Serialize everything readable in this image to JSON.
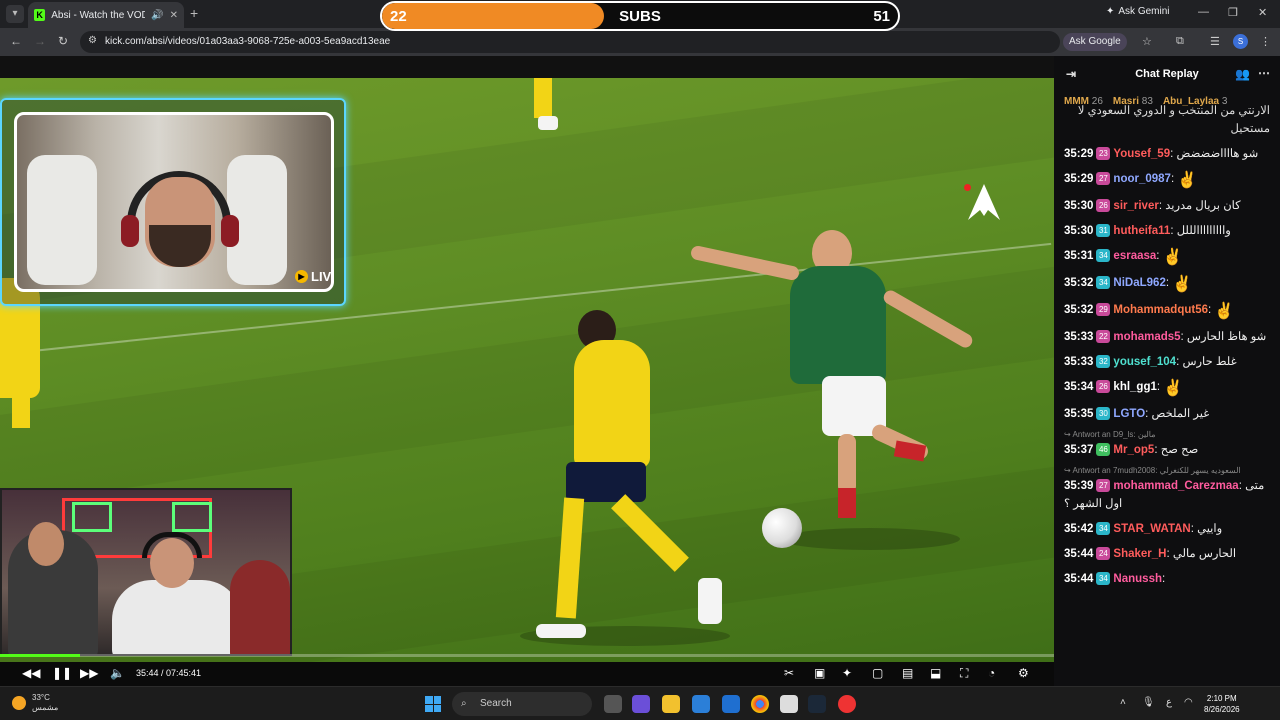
{
  "browser": {
    "tab_title": "Absi - Watch the VOD on K",
    "favicon_letter": "K",
    "url": "kick.com/absi/videos/01a03aa3-9068-725e-a003-5ea9acd13eae",
    "ask_gemini": "Ask Gemini",
    "ask_google": "Ask Google",
    "profile_initial": "S"
  },
  "subs_bar": {
    "left_value": "22",
    "label": "SUBS",
    "right_value": "51",
    "fill_fraction": 0.43,
    "fill_color": "#f08a24"
  },
  "webcam": {
    "live_label": "LIVE"
  },
  "player": {
    "time": "35:44 / 07:45:41",
    "progress_fraction": 0.076,
    "accent": "#53fc18"
  },
  "chat": {
    "title": "Chat Replay",
    "leaderboard": [
      {
        "name": "MMM",
        "count": "26"
      },
      {
        "name": "Masri",
        "count": "83"
      },
      {
        "name": "Abu_Laylaa",
        "count": "3"
      }
    ],
    "top_text": "الارنتي من المنتخب و الدوري السعودي لا مستحيل",
    "messages": [
      {
        "time": "35:29",
        "badge": "23",
        "badge_color": "#c94a9a",
        "user": "Yousef_59",
        "user_color": "#ff5c5c",
        "text": "شو هااااضضضض"
      },
      {
        "time": "35:29",
        "badge": "27",
        "badge_color": "#c94a9a",
        "user": "noor_0987",
        "user_color": "#8fa8ff",
        "text": "",
        "emote": true
      },
      {
        "time": "35:30",
        "badge": "26",
        "badge_color": "#c94a9a",
        "user": "sir_river",
        "user_color": "#ff5c5c",
        "text": "كان بريال مدريد"
      },
      {
        "time": "35:30",
        "badge": "31",
        "badge_color": "#2bb6c9",
        "user": "hutheifa11",
        "user_color": "#ff5c5c",
        "text": "وااااااااالللل"
      },
      {
        "time": "35:31",
        "badge": "34",
        "badge_color": "#2bb6c9",
        "user": "esraasa",
        "user_color": "#ff5c9e",
        "text": "",
        "emote": true
      },
      {
        "time": "35:32",
        "badge": "34",
        "badge_color": "#2bb6c9",
        "user": "NiDaL962",
        "user_color": "#8fa8ff",
        "text": "",
        "emote": true
      },
      {
        "time": "35:32",
        "badge": "29",
        "badge_color": "#c94a9a",
        "user": "Mohammadqut56",
        "user_color": "#ff7a4d",
        "text": "",
        "emote": true
      },
      {
        "time": "35:33",
        "badge": "22",
        "badge_color": "#c94a9a",
        "user": "mohamads5",
        "user_color": "#ff5c9e",
        "text": "شو هاظ الحارس"
      },
      {
        "time": "35:33",
        "badge": "32",
        "badge_color": "#2bb6c9",
        "user": "yousef_104",
        "user_color": "#4fe0d0",
        "text": "غلط حارس"
      },
      {
        "time": "35:34",
        "badge": "26",
        "badge_color": "#c94a9a",
        "user": "khl_gg1",
        "user_color": "#ffffff",
        "text": "",
        "emote": true
      },
      {
        "time": "35:35",
        "badge": "30",
        "badge_color": "#2bb6c9",
        "user": "LGTO",
        "user_color": "#8fa8ff",
        "text": "غير الملخص"
      },
      {
        "reply": "Antwort an D9_ls: مالين",
        "time": "35:37",
        "badge": "46",
        "badge_color": "#3fbf5f",
        "user": "Mr_op5",
        "user_color": "#ff5c5c",
        "text": "صح صح"
      },
      {
        "reply": "Antwort an 7mudh2008: السعوديه يسهر للكنغرلي",
        "time": "35:39",
        "badge": "27",
        "badge_color": "#c94a9a",
        "user": "mohammad_Carezmaa",
        "user_color": "#ff5c9e",
        "text": "متى اول الشهر ؟"
      },
      {
        "time": "35:42",
        "badge": "34",
        "badge_color": "#2bb6c9",
        "user": "STAR_WATAN",
        "user_color": "#ff5c5c",
        "text": "واييي"
      },
      {
        "time": "35:44",
        "badge": "24",
        "badge_color": "#c94a9a",
        "user": "Shaker_H",
        "user_color": "#ff5c5c",
        "text": "الحارس مالي"
      },
      {
        "time": "35:44",
        "badge": "34",
        "badge_color": "#2bb6c9",
        "user": "Nanussh",
        "user_color": "#ff5c9e",
        "text": ""
      }
    ]
  },
  "taskbar": {
    "temp": "33°C",
    "weather_text": "مشمس",
    "search": "Search",
    "time": "2:10 PM",
    "date": "8/26/2026"
  }
}
